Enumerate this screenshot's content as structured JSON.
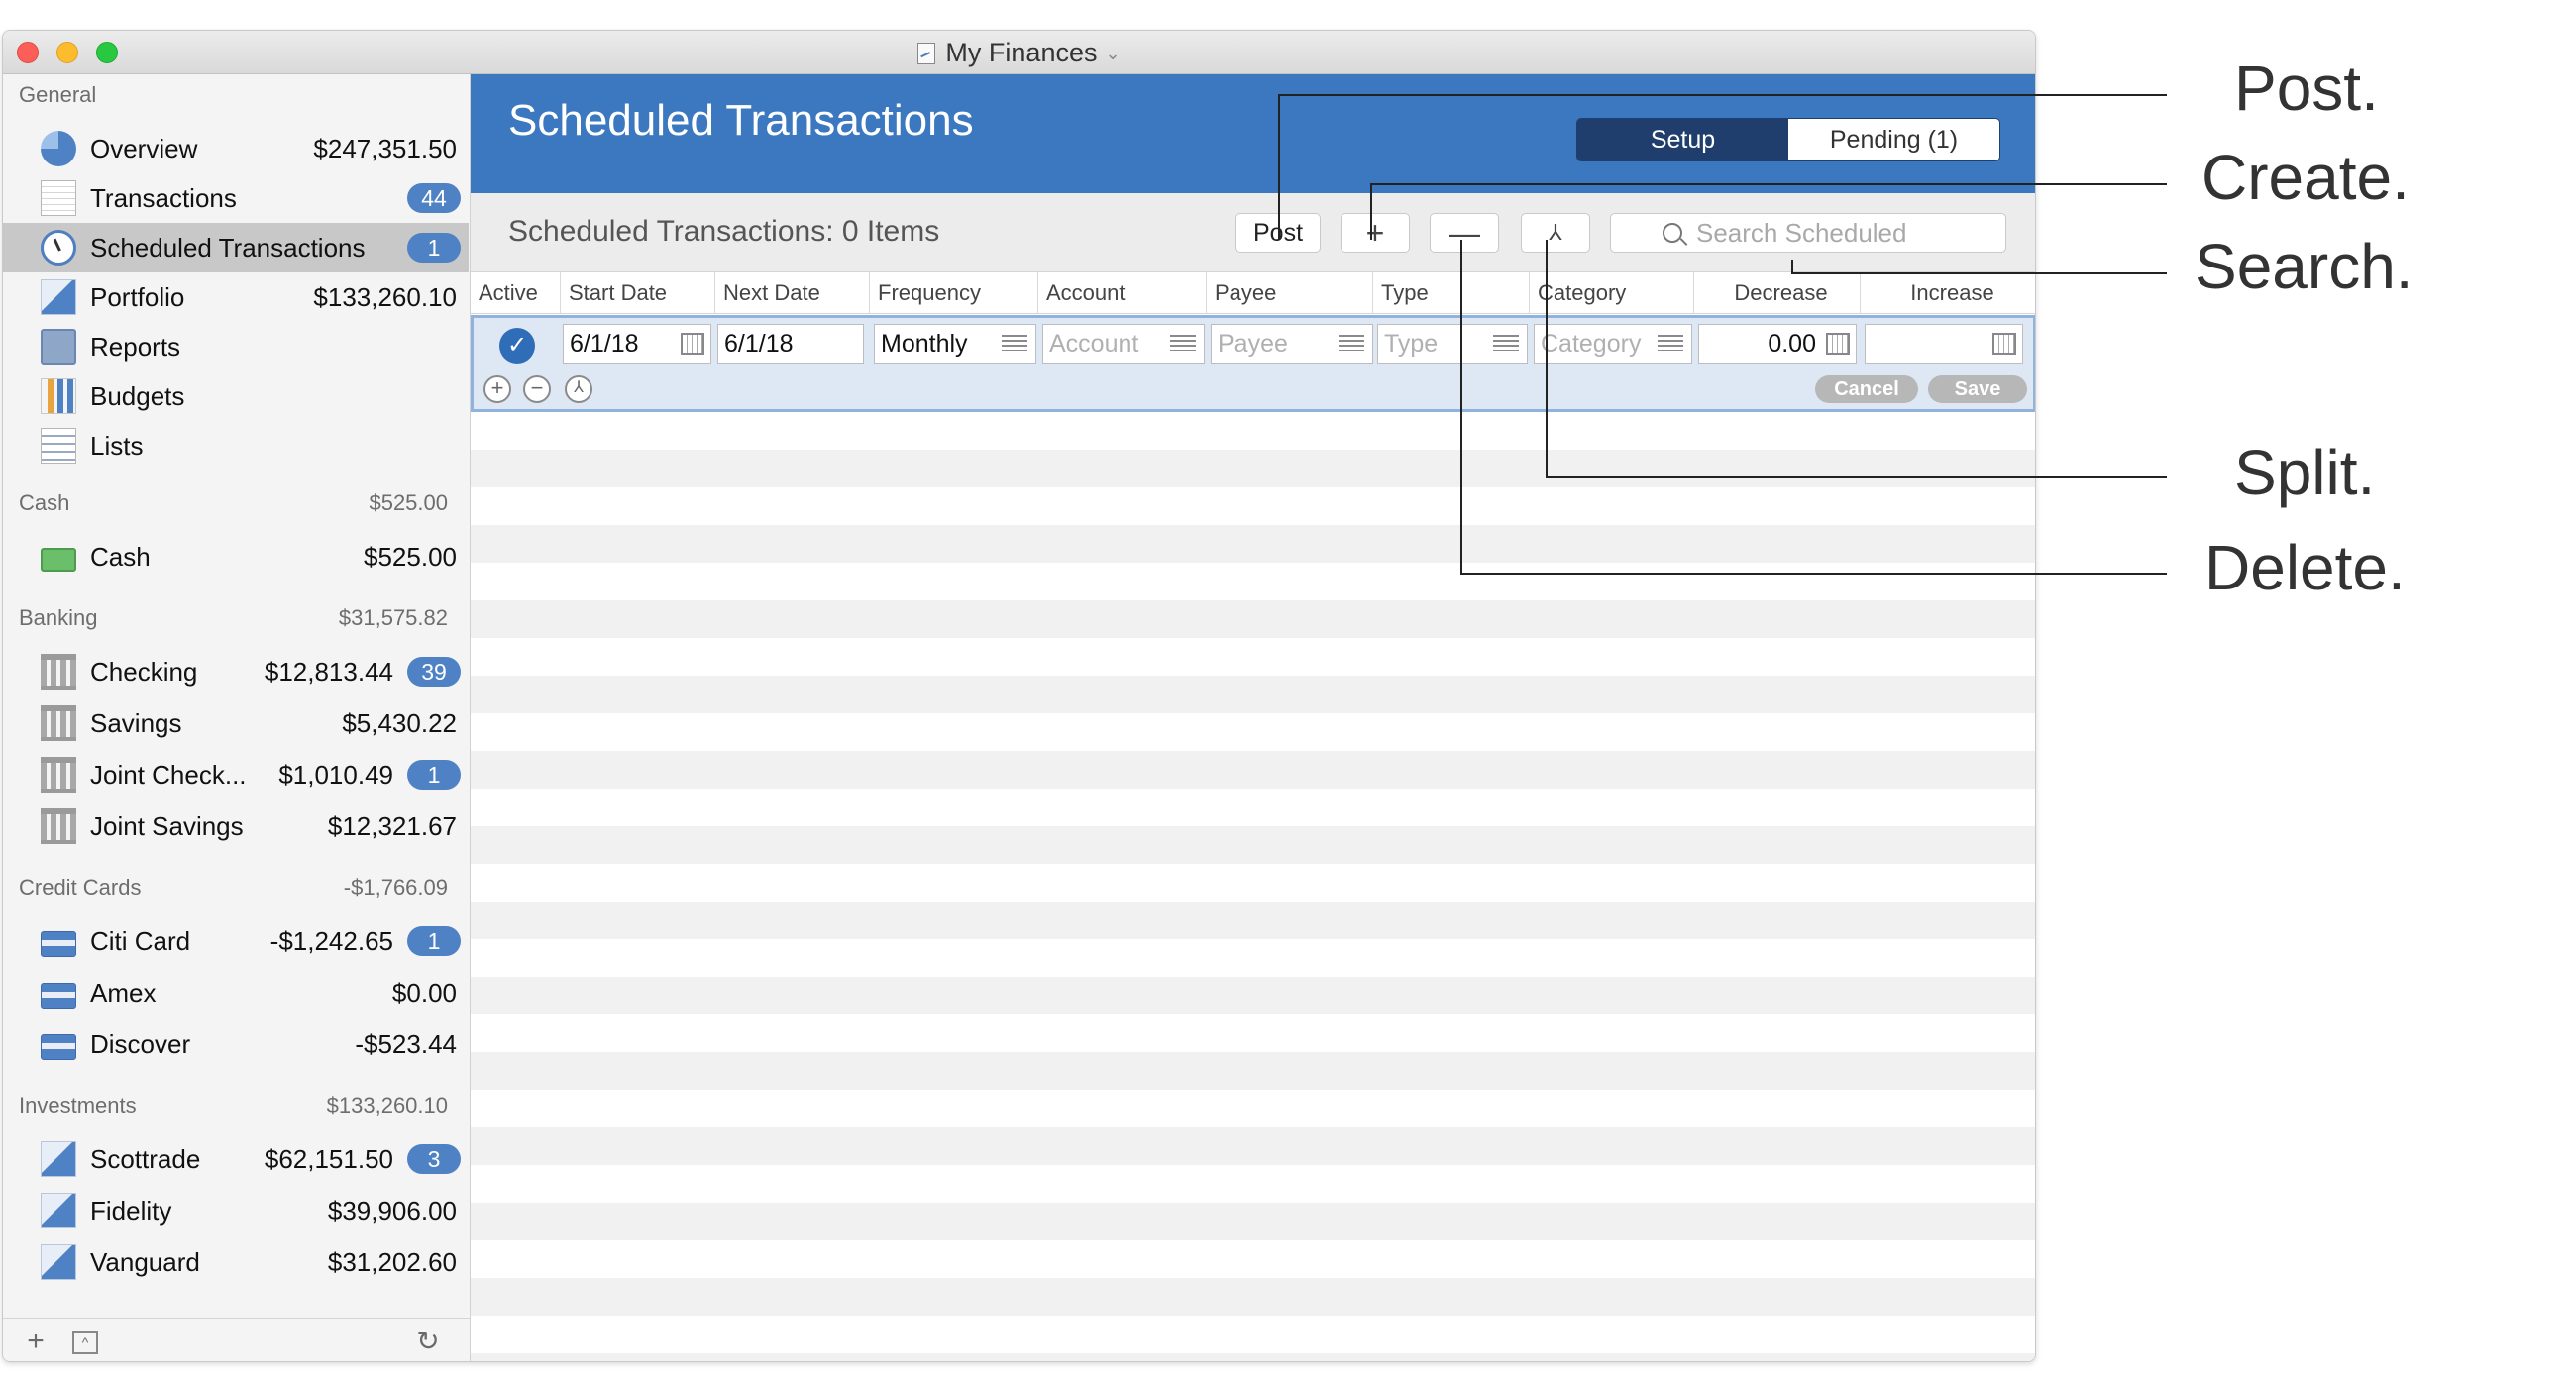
{
  "window": {
    "title": "My Finances"
  },
  "sidebar": {
    "groups": [
      {
        "header": "General",
        "total": ""
      },
      {
        "header": "Cash",
        "total": "$525.00"
      },
      {
        "header": "Banking",
        "total": "$31,575.82"
      },
      {
        "header": "Credit Cards",
        "total": "-$1,766.09"
      },
      {
        "header": "Investments",
        "total": "$133,260.10"
      }
    ],
    "items": [
      {
        "label": "Overview",
        "amount": "$247,351.50",
        "icon": "pie-chart-icon"
      },
      {
        "label": "Transactions",
        "amount": "",
        "badge": "44",
        "icon": "ledger-icon"
      },
      {
        "label": "Scheduled Transactions",
        "amount": "",
        "badge": "1",
        "icon": "clock-icon",
        "selected": true
      },
      {
        "label": "Portfolio",
        "amount": "$133,260.10",
        "icon": "line-chart-icon"
      },
      {
        "label": "Reports",
        "amount": "",
        "icon": "calculator-icon"
      },
      {
        "label": "Budgets",
        "amount": "",
        "icon": "bar-chart-icon"
      },
      {
        "label": "Lists",
        "amount": "",
        "icon": "list-icon"
      },
      {
        "label": "Cash",
        "amount": "$525.00",
        "icon": "cash-icon"
      },
      {
        "label": "Checking",
        "amount": "$12,813.44",
        "badge": "39",
        "icon": "bank-icon"
      },
      {
        "label": "Savings",
        "amount": "$5,430.22",
        "icon": "bank-icon"
      },
      {
        "label": "Joint Check...",
        "amount": "$1,010.49",
        "badge": "1",
        "icon": "bank-icon"
      },
      {
        "label": "Joint Savings",
        "amount": "$12,321.67",
        "icon": "bank-icon"
      },
      {
        "label": "Citi Card",
        "amount": "-$1,242.65",
        "badge": "1",
        "icon": "credit-card-icon"
      },
      {
        "label": "Amex",
        "amount": "$0.00",
        "icon": "credit-card-icon"
      },
      {
        "label": "Discover",
        "amount": "-$523.44",
        "icon": "credit-card-icon"
      },
      {
        "label": "Scottrade",
        "amount": "$62,151.50",
        "badge": "3",
        "icon": "line-chart-icon"
      },
      {
        "label": "Fidelity",
        "amount": "$39,906.00",
        "icon": "line-chart-icon"
      },
      {
        "label": "Vanguard",
        "amount": "$31,202.60",
        "icon": "line-chart-icon"
      }
    ],
    "footer": {
      "add": "+",
      "refresh": "↻"
    }
  },
  "main": {
    "title": "Scheduled Transactions",
    "segments": {
      "setup": "Setup",
      "pending": "Pending (1)"
    },
    "item_count": "Scheduled Transactions: 0 Items",
    "toolbar": {
      "post": "Post",
      "create": "+",
      "delete": "—",
      "split": "⅄"
    },
    "search": {
      "placeholder": "Search Scheduled",
      "value": ""
    },
    "columns": [
      "Active",
      "Start Date",
      "Next Date",
      "Frequency",
      "Account",
      "Payee",
      "Type",
      "Category",
      "Decrease",
      "Increase"
    ],
    "edit_row": {
      "active": "✓",
      "start_date": "6/1/18",
      "next_date": "6/1/18",
      "frequency": "Monthly",
      "account_placeholder": "Account",
      "payee_placeholder": "Payee",
      "type_placeholder": "Type",
      "category_placeholder": "Category",
      "decrease": "0.00",
      "increase": "",
      "cancel": "Cancel",
      "save": "Save"
    }
  },
  "callouts": {
    "post": "Post.",
    "create": "Create.",
    "search": "Search.",
    "split": "Split.",
    "delete": "Delete."
  },
  "colors": {
    "header_blue": "#3b78c0",
    "segment_active": "#1f3e6d",
    "badge_blue": "#4f82c4",
    "selected_row": "#c8c8c8"
  }
}
